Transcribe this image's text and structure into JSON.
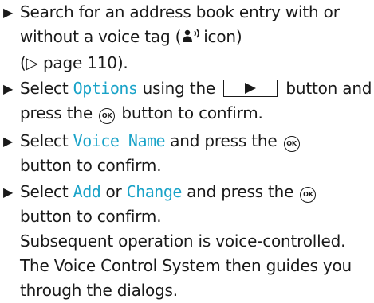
{
  "bullet": "▶",
  "steps": [
    {
      "lines": [
        "Search for an address book entry with or",
        "without a voice tag (",
        "icon)",
        "(▷ page 110)."
      ]
    },
    {
      "pre": "Select ",
      "kw": "Options",
      "mid": " using the ",
      "post": " button and",
      "line2_pre": "press the ",
      "line2_post": " button to confirm."
    },
    {
      "pre": "Select ",
      "kw": "Voice Name",
      "post": " and press the ",
      "line2": "button to confirm."
    },
    {
      "pre": "Select ",
      "kw1": "Add",
      "mid": " or ",
      "kw2": "Change",
      "post": " and press the ",
      "line2": "button to confirm.",
      "notes": [
        "Subsequent operation is voice-controlled.",
        "The Voice Control System then guides you",
        "through the dialogs."
      ]
    }
  ],
  "ok_label": "OK"
}
